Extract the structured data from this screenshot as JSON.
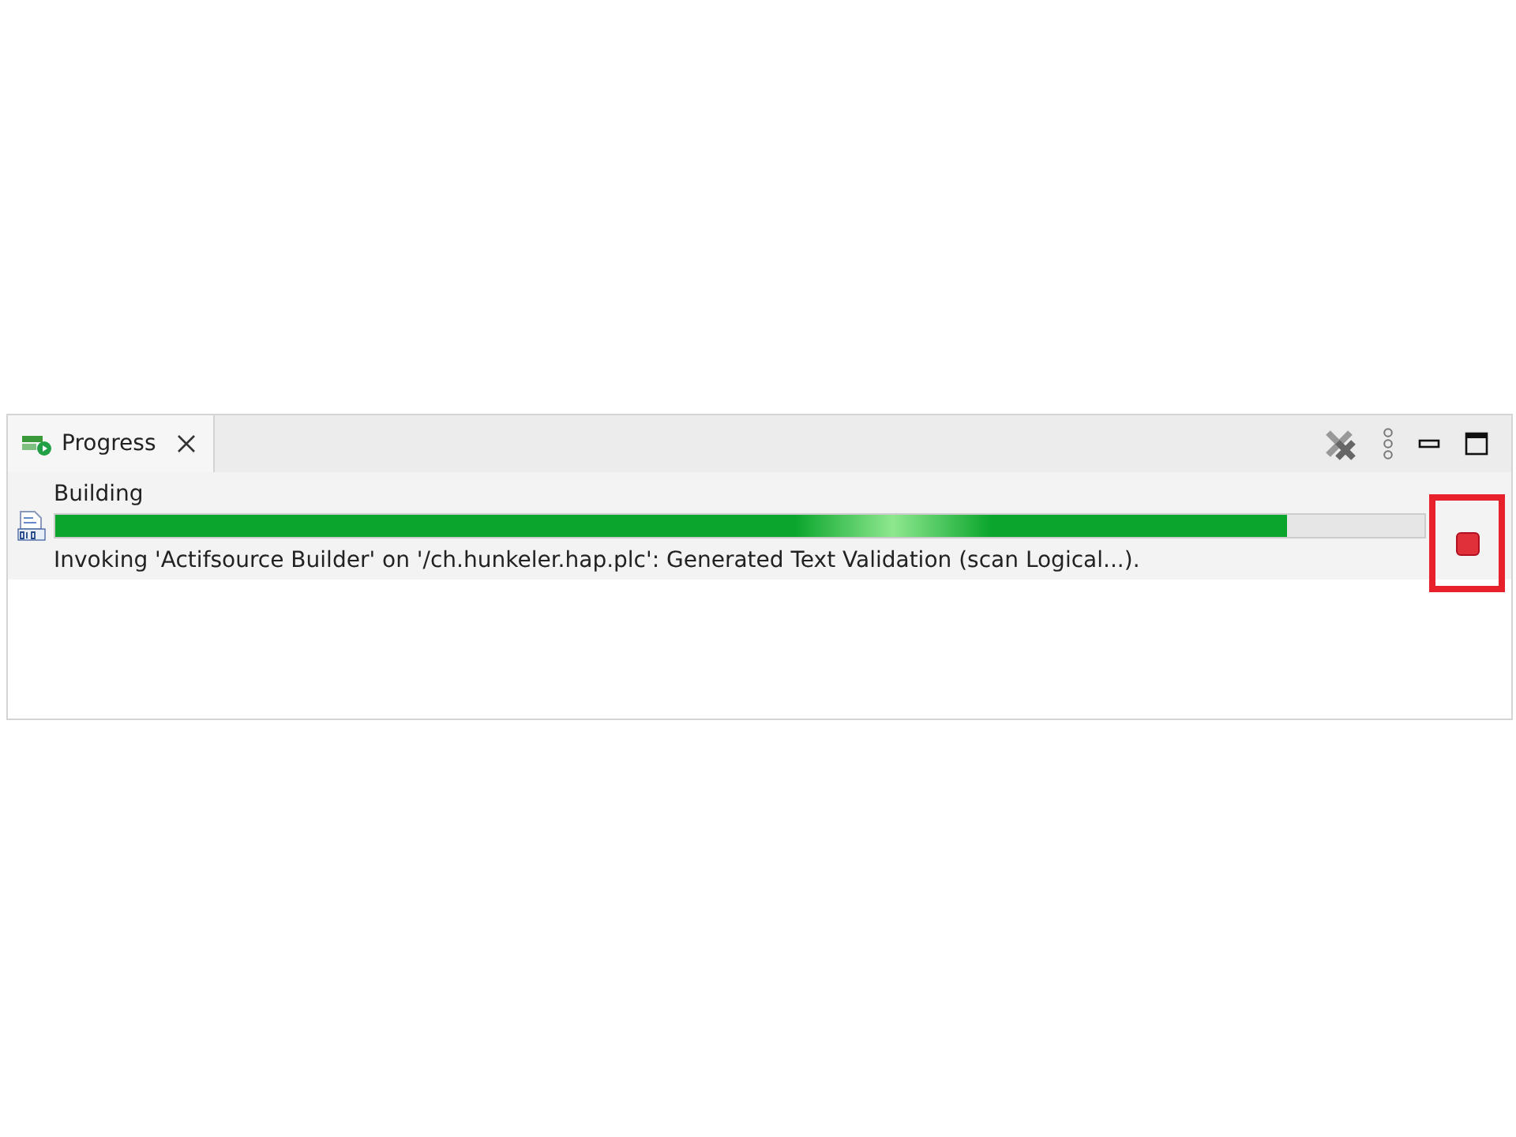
{
  "tabs": [
    {
      "label": "Progress",
      "selected": true
    }
  ],
  "job": {
    "title": "Building",
    "level": 0.9,
    "status": "Invoking 'Actifsource Builder' on '/ch.hunkeler.hap.plc': Generated Text Validation (scan Logical...).",
    "highlighted": true
  }
}
